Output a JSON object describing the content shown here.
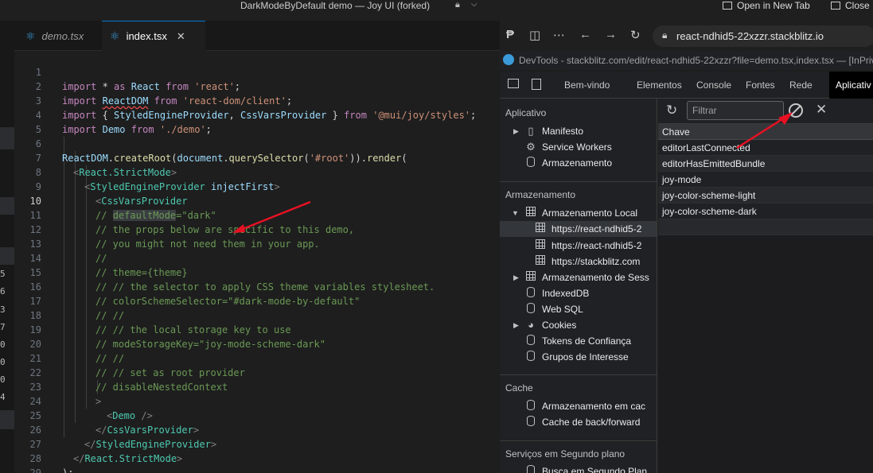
{
  "window": {
    "title": "DarkModeByDefault demo — Joy UI (forked)",
    "open_new_tab": "Open in New Tab",
    "close": "Close"
  },
  "left_gutter_numbers": [
    "5",
    "6",
    "3",
    "7",
    "0",
    "0",
    "0",
    "4"
  ],
  "tabs": [
    {
      "label": "demo.tsx",
      "active": false
    },
    {
      "label": "index.tsx",
      "active": true
    }
  ],
  "editor": {
    "active_line": 10,
    "line_numbers": [
      "1",
      "2",
      "3",
      "4",
      "5",
      "6",
      "7",
      "8",
      "9",
      "10",
      "11",
      "12",
      "13",
      "14",
      "15",
      "16",
      "17",
      "18",
      "19",
      "20",
      "21",
      "22",
      "23",
      "24",
      "25",
      "26",
      "27",
      "28",
      "29"
    ],
    "lines": {
      "l1": [
        "import",
        " * ",
        "as",
        " React ",
        "from",
        " ",
        "'react'",
        ";"
      ],
      "l2": [
        "import",
        " ",
        "ReactDOM",
        " ",
        "from",
        " ",
        "'react-dom/client'",
        ";"
      ],
      "l3": [
        "import",
        " { ",
        "StyledEngineProvider",
        ", ",
        "CssVarsProvider",
        " } ",
        "from",
        " ",
        "'@mui/joy/styles'",
        ";"
      ],
      "l4": [
        "import",
        " ",
        "Demo",
        " ",
        "from",
        " ",
        "'./demo'",
        ";"
      ],
      "l6": [
        "ReactDOM",
        ".",
        "createRoot",
        "(",
        "document",
        ".",
        "querySelector",
        "(",
        "'#root'",
        ")).",
        "render",
        "("
      ],
      "l7": [
        "<",
        "React.StrictMode",
        ">"
      ],
      "l8": [
        "<",
        "StyledEngineProvider",
        " ",
        "injectFirst",
        ">"
      ],
      "l9": [
        "<",
        "CssVarsProvider"
      ],
      "l10": [
        "// ",
        "defaultMode",
        "=\"dark\""
      ],
      "l11": "// the props below are specific to this demo,",
      "l12": "// you might not need them in your app.",
      "l13": "//",
      "l14": "// theme={theme}",
      "l15": "// // the selector to apply CSS theme variables stylesheet.",
      "l16": "// colorSchemeSelector=\"#dark-mode-by-default\"",
      "l17": "// //",
      "l18": "// // the local storage key to use",
      "l19": "// modeStorageKey=\"joy-mode-scheme-dark\"",
      "l20": "// //",
      "l21": "// // set as root provider",
      "l22": "// disableNestedContext",
      "l23": ">",
      "l24": [
        "<",
        "Demo",
        " />"
      ],
      "l25": [
        "</",
        "CssVarsProvider",
        ">"
      ],
      "l26": [
        "</",
        "StyledEngineProvider",
        ">"
      ],
      "l27": [
        "</",
        "React.StrictMode",
        ">"
      ],
      "l28": ");"
    }
  },
  "browser": {
    "url": "react-ndhid5-22xzzr.stackblitz.io"
  },
  "devtools": {
    "title": "DevTools - stackblitz.com/edit/react-ndhid5-22xzzr?file=demo.tsx,index.tsx — [InPriv",
    "tabs": [
      "Bem-vindo",
      "Elementos",
      "Console",
      "Fontes",
      "Rede",
      "Aplicativ"
    ],
    "sidebar": {
      "app_section": "Aplicativo",
      "app_items": [
        "Manifesto",
        "Service Workers",
        "Armazenamento"
      ],
      "storage_section": "Armazenamento",
      "local_storage": "Armazenamento Local",
      "local_storage_origins": [
        "https://react-ndhid5-2",
        "https://react-ndhid5-2",
        "https://stackblitz.com"
      ],
      "storage_items": [
        "Armazenamento de Sess",
        "IndexedDB",
        "Web SQL",
        "Cookies",
        "Tokens de Confiança",
        "Grupos de Interesse"
      ],
      "cache_section": "Cache",
      "cache_items": [
        "Armazenamento em cac",
        "Cache de back/forward"
      ],
      "bg_section": "Serviços em Segundo plano",
      "bg_items": [
        "Busca em Segundo Plan"
      ]
    },
    "filter_placeholder": "Filtrar",
    "key_header": "Chave",
    "keys": [
      "editorLastConnected",
      "editorHasEmittedBundle",
      "joy-mode",
      "joy-color-scheme-light",
      "joy-color-scheme-dark"
    ]
  },
  "colors": {
    "annotation_arrow": "#e81123",
    "accent": "#0078d4"
  }
}
